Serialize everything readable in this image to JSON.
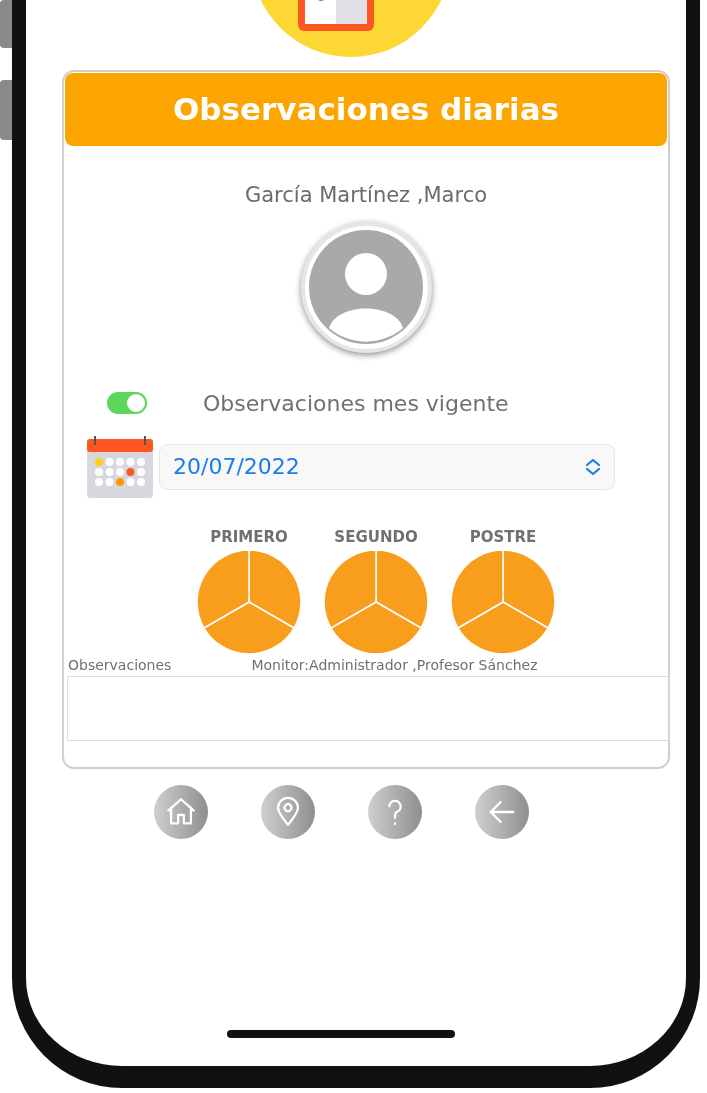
{
  "title": "Observaciones diarias",
  "student_name": "García Martínez ,Marco",
  "filter": {
    "label": "Observaciones mes vigente",
    "on": true
  },
  "date_select": {
    "value": "20/07/2022"
  },
  "meals": [
    {
      "label": "PRIMERO"
    },
    {
      "label": "SEGUNDO"
    },
    {
      "label": "POSTRE"
    }
  ],
  "observations": {
    "label": "Observaciones",
    "monitor": "Monitor:Administrador ,Profesor Sánchez"
  }
}
